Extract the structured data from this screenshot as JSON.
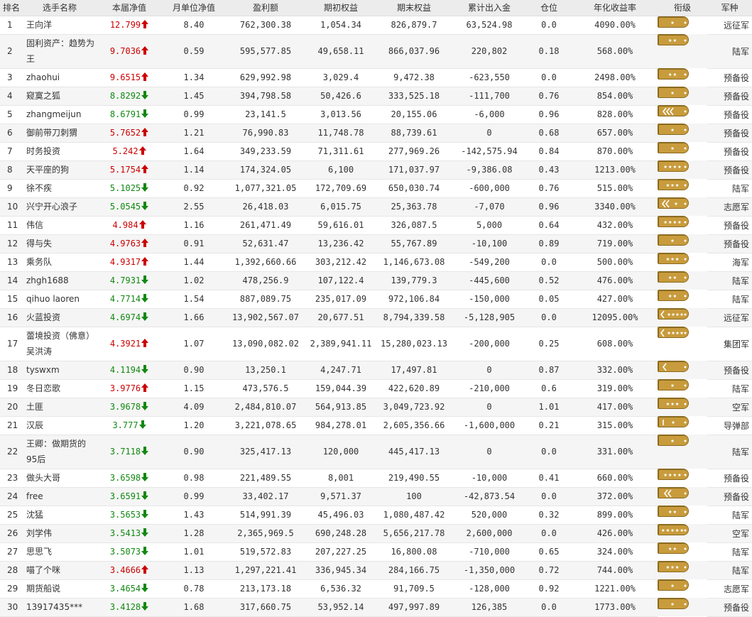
{
  "headers": {
    "rank": "排名",
    "name": "选手名称",
    "nav": "本届净值",
    "monthly_nav": "月单位净值",
    "profit": "盈利额",
    "initial": "期初权益",
    "final": "期末权益",
    "flow": "累计出入金",
    "position": "仓位",
    "annual": "年化收益率",
    "grade": "衔级",
    "army": "军种"
  },
  "colors": {
    "up": "#cc0000",
    "down": "#118811",
    "badge": "#c89b3c"
  },
  "rows": [
    {
      "rank": "1",
      "name": "王向洋",
      "nav": "12.799",
      "dir": "up",
      "mnav": "8.40",
      "profit": "762,300.38",
      "init": "1,054.34",
      "final": "826,879.7",
      "flow": "63,524.98",
      "pos": "0.0",
      "annual": "4090.00%",
      "badge": "star1",
      "army": "远征军"
    },
    {
      "rank": "2",
      "name": "固利资产：趋势为王",
      "nav": "9.7036",
      "dir": "up",
      "mnav": "0.59",
      "profit": "595,577.85",
      "init": "49,658.11",
      "final": "866,037.96",
      "flow": "220,802",
      "pos": "0.18",
      "annual": "568.00%",
      "badge": "star2",
      "army": "陆军"
    },
    {
      "rank": "3",
      "name": "zhaohui",
      "nav": "9.6515",
      "dir": "up",
      "mnav": "1.34",
      "profit": "629,992.98",
      "init": "3,029.4",
      "final": "9,472.38",
      "flow": "-623,550",
      "pos": "0.0",
      "annual": "2498.00%",
      "badge": "star2",
      "army": "预备役"
    },
    {
      "rank": "4",
      "name": "窥寞之狐",
      "nav": "8.8292",
      "dir": "down",
      "mnav": "1.45",
      "profit": "394,798.58",
      "init": "50,426.6",
      "final": "333,525.18",
      "flow": "-111,700",
      "pos": "0.76",
      "annual": "854.00%",
      "badge": "star1",
      "army": "预备役"
    },
    {
      "rank": "5",
      "name": "zhangmeijun",
      "nav": "8.6791",
      "dir": "down",
      "mnav": "0.99",
      "profit": "23,141.5",
      "init": "3,013.56",
      "final": "20,155.06",
      "flow": "-6,000",
      "pos": "0.96",
      "annual": "828.00%",
      "badge": "chev3",
      "army": "预备役"
    },
    {
      "rank": "6",
      "name": "御前带刀刺猬",
      "nav": "5.7652",
      "dir": "up",
      "mnav": "1.21",
      "profit": "76,990.83",
      "init": "11,748.78",
      "final": "88,739.61",
      "flow": "0",
      "pos": "0.68",
      "annual": "657.00%",
      "badge": "star1",
      "army": "预备役"
    },
    {
      "rank": "7",
      "name": "时务投资",
      "nav": "5.242",
      "dir": "up",
      "mnav": "1.64",
      "profit": "349,233.59",
      "init": "71,311.61",
      "final": "277,969.26",
      "flow": "-142,575.94",
      "pos": "0.84",
      "annual": "870.00%",
      "badge": "star1",
      "army": "预备役"
    },
    {
      "rank": "8",
      "name": "天平座的狗",
      "nav": "5.1754",
      "dir": "up",
      "mnav": "1.14",
      "profit": "174,324.05",
      "init": "6,100",
      "final": "171,037.97",
      "flow": "-9,386.08",
      "pos": "0.43",
      "annual": "1213.00%",
      "badge": "star4",
      "army": "预备役"
    },
    {
      "rank": "9",
      "name": "徐不疾",
      "nav": "5.1025",
      "dir": "down",
      "mnav": "0.92",
      "profit": "1,077,321.05",
      "init": "172,709.69",
      "final": "650,030.74",
      "flow": "-600,000",
      "pos": "0.76",
      "annual": "515.00%",
      "badge": "star3",
      "army": "陆军"
    },
    {
      "rank": "10",
      "name": "兴宁开心浪子",
      "nav": "5.0545",
      "dir": "down",
      "mnav": "2.55",
      "profit": "26,418.03",
      "init": "6,015.75",
      "final": "25,363.78",
      "flow": "-7,070",
      "pos": "0.96",
      "annual": "3340.00%",
      "badge": "chev2star",
      "army": "志愿军"
    },
    {
      "rank": "11",
      "name": "伟信",
      "nav": "4.984",
      "dir": "up",
      "mnav": "1.16",
      "profit": "261,471.49",
      "init": "59,616.01",
      "final": "326,087.5",
      "flow": "5,000",
      "pos": "0.64",
      "annual": "432.00%",
      "badge": "star4",
      "army": "预备役"
    },
    {
      "rank": "12",
      "name": "得与失",
      "nav": "4.9763",
      "dir": "up",
      "mnav": "0.91",
      "profit": "52,631.47",
      "init": "13,236.42",
      "final": "55,767.89",
      "flow": "-10,100",
      "pos": "0.89",
      "annual": "719.00%",
      "badge": "star1",
      "army": "预备役"
    },
    {
      "rank": "13",
      "name": "乘务队",
      "nav": "4.9317",
      "dir": "up",
      "mnav": "1.44",
      "profit": "1,392,660.66",
      "init": "303,212.42",
      "final": "1,146,673.08",
      "flow": "-549,200",
      "pos": "0.0",
      "annual": "500.00%",
      "badge": "star3",
      "army": "海军"
    },
    {
      "rank": "14",
      "name": "zhgh1688",
      "nav": "4.7931",
      "dir": "down",
      "mnav": "1.02",
      "profit": "478,256.9",
      "init": "107,122.4",
      "final": "139,779.3",
      "flow": "-445,600",
      "pos": "0.52",
      "annual": "476.00%",
      "badge": "star2",
      "army": "陆军"
    },
    {
      "rank": "15",
      "name": "qihuo laoren",
      "nav": "4.7714",
      "dir": "down",
      "mnav": "1.54",
      "profit": "887,089.75",
      "init": "235,017.09",
      "final": "972,106.84",
      "flow": "-150,000",
      "pos": "0.05",
      "annual": "427.00%",
      "badge": "star2",
      "army": "陆军"
    },
    {
      "rank": "16",
      "name": "火蓝投资",
      "nav": "4.6974",
      "dir": "down",
      "mnav": "1.66",
      "profit": "13,902,567.07",
      "init": "20,677.51",
      "final": "8,794,339.58",
      "flow": "-5,128,905",
      "pos": "0.0",
      "annual": "12095.00%",
      "badge": "chev4star",
      "army": "远征军"
    },
    {
      "rank": "17",
      "name": "蕾境投资（佛意）吴洪涛",
      "nav": "4.3921",
      "dir": "up",
      "mnav": "1.07",
      "profit": "13,090,082.02",
      "init": "2,389,941.11",
      "final": "15,280,023.13",
      "flow": "-200,000",
      "pos": "0.25",
      "annual": "608.00%",
      "badge": "chev4star",
      "army": "集团军"
    },
    {
      "rank": "18",
      "name": "tyswxm",
      "nav": "4.1194",
      "dir": "down",
      "mnav": "0.90",
      "profit": "13,250.1",
      "init": "4,247.71",
      "final": "17,497.81",
      "flow": "0",
      "pos": "0.87",
      "annual": "332.00%",
      "badge": "chev1",
      "army": "预备役"
    },
    {
      "rank": "19",
      "name": "冬日恋歌",
      "nav": "3.9776",
      "dir": "up",
      "mnav": "1.15",
      "profit": "473,576.5",
      "init": "159,044.39",
      "final": "422,620.89",
      "flow": "-210,000",
      "pos": "0.6",
      "annual": "319.00%",
      "badge": "star1",
      "army": "陆军"
    },
    {
      "rank": "20",
      "name": "土匪",
      "nav": "3.9678",
      "dir": "down",
      "mnav": "4.09",
      "profit": "2,484,810.07",
      "init": "564,913.85",
      "final": "3,049,723.92",
      "flow": "0",
      "pos": "1.01",
      "annual": "417.00%",
      "badge": "star3",
      "army": "空军"
    },
    {
      "rank": "21",
      "name": "汉辰",
      "nav": "3.777",
      "dir": "down",
      "mnav": "1.20",
      "profit": "3,221,078.65",
      "init": "984,278.01",
      "final": "2,605,356.66",
      "flow": "-1,600,000",
      "pos": "0.21",
      "annual": "315.00%",
      "badge": "bar1star",
      "army": "导弹部"
    },
    {
      "rank": "22",
      "name": "王卿：做期货的95后",
      "nav": "3.7118",
      "dir": "down",
      "mnav": "0.90",
      "profit": "325,417.13",
      "init": "120,000",
      "final": "445,417.13",
      "flow": "0",
      "pos": "0.0",
      "annual": "331.00%",
      "badge": "star1",
      "army": "陆军"
    },
    {
      "rank": "23",
      "name": "做头大哥",
      "nav": "3.6598",
      "dir": "down",
      "mnav": "0.98",
      "profit": "221,489.55",
      "init": "8,001",
      "final": "219,490.55",
      "flow": "-10,000",
      "pos": "0.41",
      "annual": "660.00%",
      "badge": "star4",
      "army": "预备役"
    },
    {
      "rank": "24",
      "name": "free",
      "nav": "3.6591",
      "dir": "down",
      "mnav": "0.99",
      "profit": "33,402.17",
      "init": "9,571.37",
      "final": "100",
      "flow": "-42,873.54",
      "pos": "0.0",
      "annual": "372.00%",
      "badge": "chev2",
      "army": "预备役"
    },
    {
      "rank": "25",
      "name": "沈猛",
      "nav": "3.5653",
      "dir": "down",
      "mnav": "1.43",
      "profit": "514,991.39",
      "init": "45,496.03",
      "final": "1,080,487.42",
      "flow": "520,000",
      "pos": "0.32",
      "annual": "899.00%",
      "badge": "star2",
      "army": "陆军"
    },
    {
      "rank": "26",
      "name": "刘学伟",
      "nav": "3.5413",
      "dir": "down",
      "mnav": "1.28",
      "profit": "2,365,969.5",
      "init": "690,248.28",
      "final": "5,656,217.78",
      "flow": "2,600,000",
      "pos": "0.0",
      "annual": "426.00%",
      "badge": "star5",
      "army": "空军"
    },
    {
      "rank": "27",
      "name": "思思飞",
      "nav": "3.5073",
      "dir": "down",
      "mnav": "1.01",
      "profit": "519,572.83",
      "init": "207,227.25",
      "final": "16,800.08",
      "flow": "-710,000",
      "pos": "0.65",
      "annual": "324.00%",
      "badge": "star2",
      "army": "陆军"
    },
    {
      "rank": "28",
      "name": "喵了个咪",
      "nav": "3.4666",
      "dir": "up",
      "mnav": "1.13",
      "profit": "1,297,221.41",
      "init": "336,945.34",
      "final": "284,166.75",
      "flow": "-1,350,000",
      "pos": "0.72",
      "annual": "744.00%",
      "badge": "star3",
      "army": "陆军"
    },
    {
      "rank": "29",
      "name": "期货船说",
      "nav": "3.4654",
      "dir": "down",
      "mnav": "0.78",
      "profit": "213,173.18",
      "init": "6,536.32",
      "final": "91,709.5",
      "flow": "-128,000",
      "pos": "0.92",
      "annual": "1221.00%",
      "badge": "star1",
      "army": "志愿军"
    },
    {
      "rank": "30",
      "name": "13917435***",
      "nav": "3.4128",
      "dir": "down",
      "mnav": "1.68",
      "profit": "317,660.75",
      "init": "53,952.14",
      "final": "497,997.89",
      "flow": "126,385",
      "pos": "0.0",
      "annual": "1773.00%",
      "badge": "star1",
      "army": "预备役"
    }
  ]
}
